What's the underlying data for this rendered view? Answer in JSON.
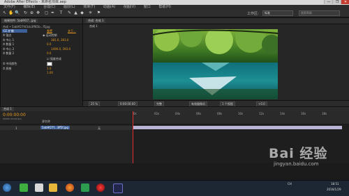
{
  "window": {
    "title": "Adobe After Effects - 未命名项目.aep",
    "min": "—",
    "max": "❐",
    "close": "✕"
  },
  "menu": [
    "文件(F)",
    "编辑(E)",
    "合成(C)",
    "图层(L)",
    "效果(T)",
    "动画(A)",
    "视图(V)",
    "窗口",
    "帮助(H)"
  ],
  "toolbar": {
    "tools": [
      "↖",
      "✋",
      "🔍",
      "↻",
      "⊕",
      "✥",
      "◻",
      "✒",
      "T",
      "✎",
      "▲",
      "◆",
      "✳",
      "⚑"
    ],
    "workspace_label": "工作区:",
    "workspace_value": "标准",
    "search_placeholder": "搜索帮助"
  },
  "effects_panel": {
    "tab": "效果控件: 5ab9f27...jpg",
    "layer_path": "合成 • 5ab9f27fd3cb3ff85b...f5jpg",
    "effect_name": "CC 扩散",
    "reset": "重置",
    "about": "关于...",
    "rows": [
      {
        "label": "锚点",
        "value": "",
        "text": "◉ 运动控制"
      },
      {
        "label": "中心 1",
        "value": "381.0, 393.0"
      },
      {
        "label": "数量 1",
        "value": "0.0"
      },
      {
        "label": "中心 2",
        "value": "1490.0, 393.0"
      },
      {
        "label": "数量 2",
        "value": "0.0"
      },
      {
        "label": "",
        "value": "",
        "text": "☑ 弧度合成"
      },
      {
        "label": "中间颜色",
        "value": ""
      },
      {
        "label": "质感",
        "value": "1.0"
      },
      {
        "label": "",
        "value": "1.00"
      }
    ]
  },
  "comp_panel": {
    "tab": "合成: 合成 1",
    "subtab": "合成 1"
  },
  "viewer_controls": {
    "zoom": "25 %",
    "timecode": "0:00:00:00",
    "resolution": "完整",
    "camera": "有效摄像机",
    "views": "1 个视图",
    "exposure": "+0.0"
  },
  "timeline": {
    "tab": "合成 1",
    "timecode": "0:00:00:00",
    "fps": "00000 (25.00 fps)",
    "layer_header": "源名称",
    "layer_number": "1",
    "layer_name": "5ab9f27f...3ff5f.jpg",
    "mode": "无",
    "ruler": [
      "0s",
      "02s",
      "04s",
      "06s",
      "08s",
      "10s",
      "12s",
      "14s",
      "16s",
      "18s"
    ]
  },
  "taskbar": {
    "time": "18:51",
    "date": "2016/1/29",
    "lang": "CH"
  },
  "watermark": {
    "brand": "Bai 经验",
    "url": "jingyan.baidu.com"
  }
}
